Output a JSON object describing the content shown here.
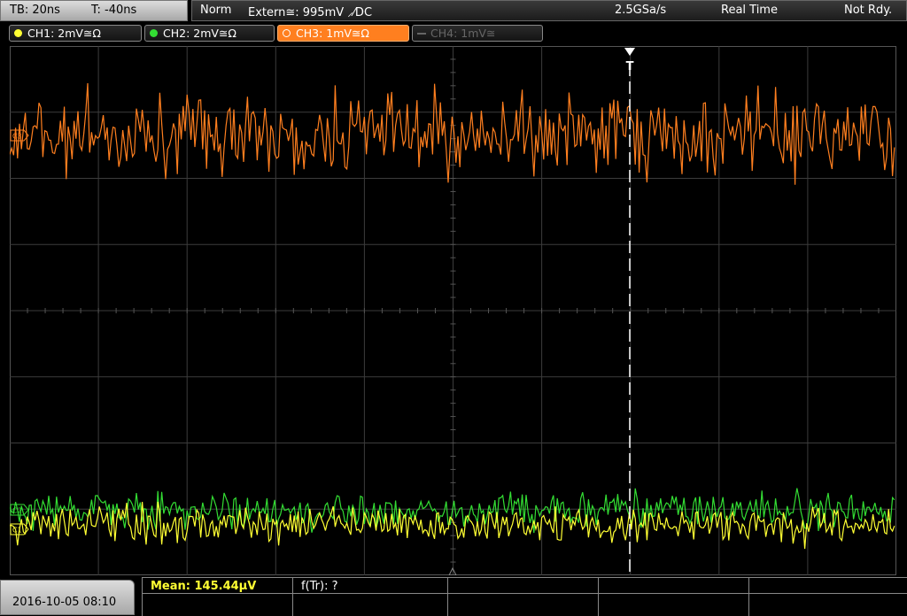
{
  "topbar": {
    "timebase": "TB: 20ns",
    "trigger_time": "T: -40ns",
    "mode": "Norm",
    "trigger_source": "Extern≅: 995mV ⸝⁄DC",
    "sample_rate": "2.5GSa/s",
    "acq_mode": "Real Time",
    "status": "Not Rdy."
  },
  "channels": [
    {
      "label": "CH1: 2mV≅Ω",
      "color": "#ffff33",
      "active": true
    },
    {
      "label": "CH2: 2mV≅Ω",
      "color": "#33dd33",
      "active": true
    },
    {
      "label": "CH3: 1mV≅Ω",
      "color": "#ff7f1f",
      "active": true,
      "selected": true
    },
    {
      "label": "CH4: 1mV≅",
      "color": "#666666",
      "active": false
    }
  ],
  "trigger_marker": "T",
  "markers": {
    "ch1": "C1",
    "ch2": "C2",
    "ch3": "C3"
  },
  "bottom": {
    "datetime": "2016-10-05 08:10",
    "mean": "Mean: 145.44µV",
    "ftr": "f(Tr): ?"
  },
  "colors": {
    "grid": "#3c3c3c",
    "ch1": "#ffff33",
    "ch2": "#33dd33",
    "ch3": "#ff7f1f"
  }
}
